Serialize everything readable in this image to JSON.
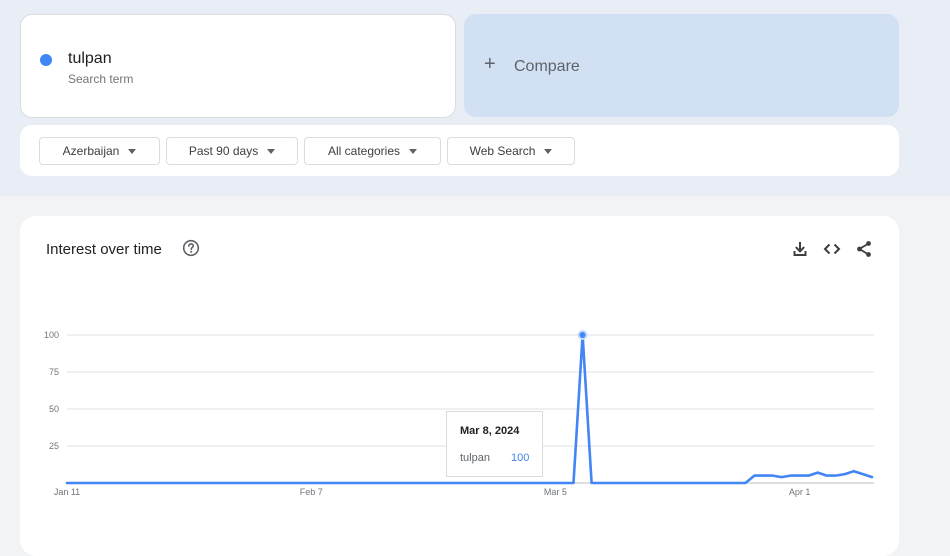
{
  "search_term": {
    "name": "tulpan",
    "subtitle": "Search term",
    "color": "#4285f4"
  },
  "compare": {
    "label": "Compare",
    "icon": "plus-icon"
  },
  "filters": [
    {
      "label": "Azerbaijan"
    },
    {
      "label": "Past 90 days"
    },
    {
      "label": "All categories"
    },
    {
      "label": "Web Search"
    }
  ],
  "interest_panel": {
    "title": "Interest over time",
    "help_icon": "help-circle-icon",
    "actions": [
      "download-icon",
      "embed-code-icon",
      "share-icon"
    ]
  },
  "tooltip": {
    "date": "Mar 8, 2024",
    "term": "tulpan",
    "value": "100"
  },
  "chart_data": {
    "type": "line",
    "x": [
      "2024-01-11",
      "2024-01-12",
      "2024-01-13",
      "2024-01-14",
      "2024-01-15",
      "2024-01-16",
      "2024-01-17",
      "2024-01-18",
      "2024-01-19",
      "2024-01-20",
      "2024-01-21",
      "2024-01-22",
      "2024-01-23",
      "2024-01-24",
      "2024-01-25",
      "2024-01-26",
      "2024-01-27",
      "2024-01-28",
      "2024-01-29",
      "2024-01-30",
      "2024-01-31",
      "2024-02-01",
      "2024-02-02",
      "2024-02-03",
      "2024-02-04",
      "2024-02-05",
      "2024-02-06",
      "2024-02-07",
      "2024-02-08",
      "2024-02-09",
      "2024-02-10",
      "2024-02-11",
      "2024-02-12",
      "2024-02-13",
      "2024-02-14",
      "2024-02-15",
      "2024-02-16",
      "2024-02-17",
      "2024-02-18",
      "2024-02-19",
      "2024-02-20",
      "2024-02-21",
      "2024-02-22",
      "2024-02-23",
      "2024-02-24",
      "2024-02-25",
      "2024-02-26",
      "2024-02-27",
      "2024-02-28",
      "2024-02-29",
      "2024-03-01",
      "2024-03-02",
      "2024-03-03",
      "2024-03-04",
      "2024-03-05",
      "2024-03-06",
      "2024-03-07",
      "2024-03-08",
      "2024-03-09",
      "2024-03-10",
      "2024-03-11",
      "2024-03-12",
      "2024-03-13",
      "2024-03-14",
      "2024-03-15",
      "2024-03-16",
      "2024-03-17",
      "2024-03-18",
      "2024-03-19",
      "2024-03-20",
      "2024-03-21",
      "2024-03-22",
      "2024-03-23",
      "2024-03-24",
      "2024-03-25",
      "2024-03-26",
      "2024-03-27",
      "2024-03-28",
      "2024-03-29",
      "2024-03-30",
      "2024-03-31",
      "2024-04-01",
      "2024-04-02",
      "2024-04-03",
      "2024-04-04",
      "2024-04-05",
      "2024-04-06",
      "2024-04-07",
      "2024-04-08",
      "2024-04-09"
    ],
    "series": [
      {
        "name": "tulpan",
        "values": [
          0,
          0,
          0,
          0,
          0,
          0,
          0,
          0,
          0,
          0,
          0,
          0,
          0,
          0,
          0,
          0,
          0,
          0,
          0,
          0,
          0,
          0,
          0,
          0,
          0,
          0,
          0,
          0,
          0,
          0,
          0,
          0,
          0,
          0,
          0,
          0,
          0,
          0,
          0,
          0,
          0,
          0,
          0,
          0,
          0,
          0,
          0,
          0,
          0,
          0,
          0,
          0,
          0,
          0,
          0,
          0,
          0,
          100,
          0,
          0,
          0,
          0,
          0,
          0,
          0,
          0,
          0,
          0,
          0,
          0,
          0,
          0,
          0,
          0,
          0,
          0,
          5,
          5,
          5,
          4,
          5,
          5,
          5,
          7,
          5,
          5,
          6,
          8,
          6,
          4,
          5
        ]
      }
    ],
    "x_ticks": [
      {
        "date": "2024-01-11",
        "label": "Jan 11"
      },
      {
        "date": "2024-02-07",
        "label": "Feb 7"
      },
      {
        "date": "2024-03-05",
        "label": "Mar 5"
      },
      {
        "date": "2024-04-01",
        "label": "Apr 1"
      }
    ],
    "y_ticks": [
      25,
      50,
      75,
      100
    ],
    "ylim": [
      0,
      100
    ],
    "grid": true,
    "highlight": {
      "date": "2024-03-08",
      "value": 100
    },
    "line_color": "#4285f4",
    "grid_color": "#e0e0e0"
  }
}
